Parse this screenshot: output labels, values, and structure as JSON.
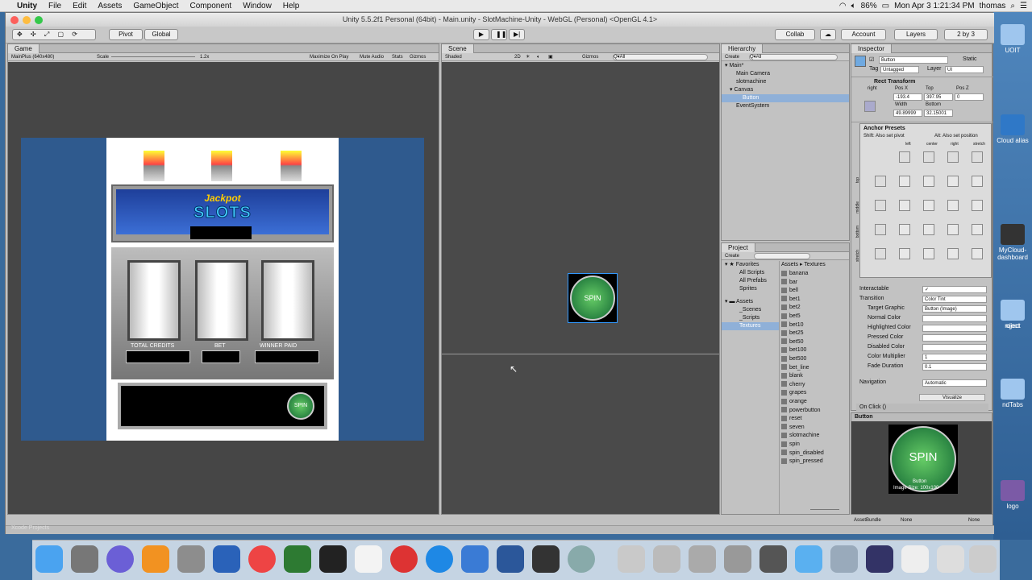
{
  "menubar": {
    "app": "Unity",
    "items": [
      "File",
      "Edit",
      "Assets",
      "GameObject",
      "Component",
      "Window",
      "Help"
    ],
    "battery": "86%",
    "clock": "Mon Apr 3  1:21:34 PM",
    "user": "thomas"
  },
  "window": {
    "title": "Unity 5.5.2f1 Personal (64bit) - Main.unity - SlotMachine-Unity - WebGL (Personal) <OpenGL 4.1>"
  },
  "toolbar": {
    "pivot": "Pivot",
    "global": "Global",
    "collab": "Collab",
    "account": "Account",
    "layers": "Layers",
    "layout": "2 by 3"
  },
  "game": {
    "tab": "Game",
    "display": "MainPlus (640x480)",
    "scale_label": "Scale",
    "scale_value": "1.2x",
    "maximize": "Maximize On Play",
    "mute": "Mute Audio",
    "stats": "Stats",
    "gizmos": "Gizmos",
    "jackpot": "Jackpot",
    "slots": "SLOTS",
    "total_credits": "TOTAL CREDITS",
    "bet": "BET",
    "winner_paid": "WINNER PAID",
    "spin": "SPIN"
  },
  "scene": {
    "tab": "Scene",
    "shaded": "Shaded",
    "mode2d": "2D",
    "gizmos": "Gizmos",
    "search": "Q▾All",
    "spin": "SPIN"
  },
  "hierarchy": {
    "tab": "Hierarchy",
    "create": "Create",
    "search": "Q▾All",
    "items": [
      "Main*",
      "Main Camera",
      "slotmachine",
      "Canvas",
      "Button",
      "EventSystem"
    ]
  },
  "project": {
    "tab": "Project",
    "create": "Create",
    "favorites": "Favorites",
    "fav_items": [
      "All Scripts",
      "All Prefabs",
      "Sprites"
    ],
    "assets": "Assets",
    "asset_items": [
      "_Scenes",
      "_Scripts",
      "Textures"
    ],
    "breadcrumb_assets": "Assets",
    "breadcrumb_textures": "Textures",
    "files": [
      "banana",
      "bar",
      "bell",
      "bet1",
      "bet2",
      "bet5",
      "bet10",
      "bet25",
      "bet50",
      "bet100",
      "bet500",
      "bet_line",
      "blank",
      "cherry",
      "grapes",
      "orange",
      "powerbutton",
      "reset",
      "seven",
      "slotmachine",
      "spin",
      "spin_disabled",
      "spin_pressed"
    ],
    "dock_label": "Xcode Projects"
  },
  "inspector": {
    "tab": "Inspector",
    "name": "Button",
    "static": "Static",
    "tag_label": "Tag",
    "tag": "Untagged",
    "layer_label": "Layer",
    "layer": "UI",
    "rect_transform": "Rect Transform",
    "anchor_h": "right",
    "anchor_v": "stretch",
    "posx_label": "Pos X",
    "top_label": "Top",
    "posz_label": "Pos Z",
    "posx": "-193.4",
    "top": "397.95",
    "posz": "0",
    "width_label": "Width",
    "bottom_label": "Bottom",
    "width": "49.89999",
    "bottom": "32.15001",
    "anchor_presets": "Anchor Presets",
    "shift_hint": "Shift: Also set pivot",
    "alt_hint": "Alt: Also set position",
    "cols": [
      "left",
      "center",
      "right",
      "stretch"
    ],
    "rows": [
      "top",
      "middle",
      "bottom",
      "stretch"
    ],
    "props": [
      {
        "label": "Interactable",
        "value": "✓"
      },
      {
        "label": "Transition",
        "value": "Color Tint"
      },
      {
        "label": "Target Graphic",
        "value": "Button (Image)"
      },
      {
        "label": "Normal Color",
        "value": ""
      },
      {
        "label": "Highlighted Color",
        "value": ""
      },
      {
        "label": "Pressed Color",
        "value": ""
      },
      {
        "label": "Disabled Color",
        "value": ""
      },
      {
        "label": "Color Multiplier",
        "value": "1"
      },
      {
        "label": "Fade Duration",
        "value": "0.1"
      },
      {
        "label": "Navigation",
        "value": "Automatic"
      }
    ],
    "visualize": "Visualize",
    "onclick": "On Click ()",
    "preview_title": "Button",
    "preview_spin": "SPIN",
    "preview_caption1": "Button",
    "preview_caption2": "Image Size: 100x100",
    "assetbundle": "AssetBundle",
    "none1": "None",
    "none2": "None"
  },
  "desktop": [
    {
      "label": "UOIT"
    },
    {
      "label": "Cloud alias"
    },
    {
      "label": "MyCloud-dashboard"
    },
    {
      "label": "oject"
    },
    {
      "label": "roject"
    },
    {
      "label": "ndTabs"
    },
    {
      "label": "logo"
    }
  ]
}
